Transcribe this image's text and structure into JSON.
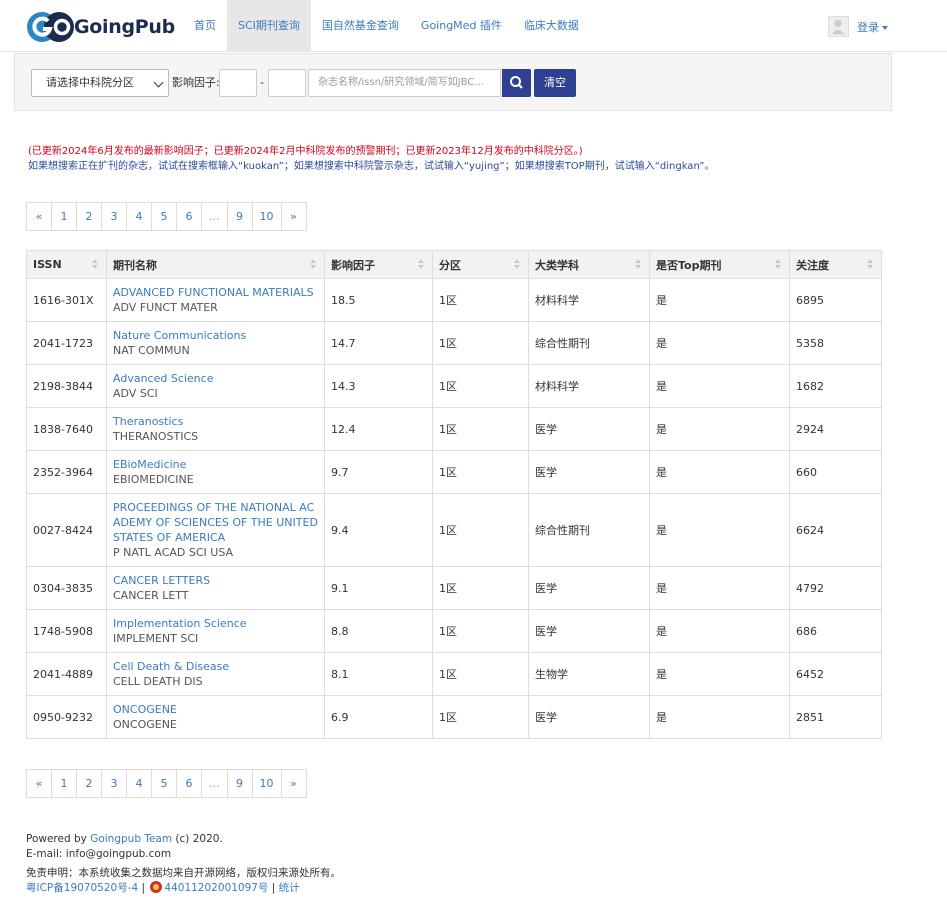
{
  "header": {
    "brand": "GoingPub",
    "nav": [
      "首页",
      "SCI期刊查询",
      "国自然基金查询",
      "GoingMed 插件",
      "临床大数据"
    ],
    "active_index": 1,
    "login": "登录"
  },
  "search": {
    "select_value": "请选择中科院分区",
    "impact_label": "影响因子:",
    "dash": "-",
    "placeholder": "杂志名称/issn/研究领域/简写如JBC...",
    "clear_label": "清空"
  },
  "notices": {
    "red": "(已更新2024年6月发布的最新影响因子；已更新2024年2月中科院发布的预警期刊；已更新2023年12月发布的中科院分区。)",
    "blue": "如果想搜索正在扩刊的杂志，试试在搜索框输入“kuokan”；如果想搜索中科院警示杂志，试试输入“yujing”；如果想搜索TOP期刊，试试输入“dingkan”。"
  },
  "pagination": [
    "«",
    "1",
    "2",
    "3",
    "4",
    "5",
    "6",
    "...",
    "9",
    "10",
    "»"
  ],
  "table": {
    "headers": [
      "ISSN",
      "期刊名称",
      "影响因子",
      "分区",
      "大类学科",
      "是否Top期刊",
      "关注度"
    ],
    "rows": [
      {
        "issn": "1616-301X",
        "name": "ADVANCED FUNCTIONAL MATERIALS",
        "abbr": "ADV FUNCT MATER",
        "if": "18.5",
        "zone": "1区",
        "subject": "材料科学",
        "top": "是",
        "attention": "6895"
      },
      {
        "issn": "2041-1723",
        "name": "Nature Communications",
        "abbr": "NAT COMMUN",
        "if": "14.7",
        "zone": "1区",
        "subject": "综合性期刊",
        "top": "是",
        "attention": "5358"
      },
      {
        "issn": "2198-3844",
        "name": "Advanced Science",
        "abbr": "ADV SCI",
        "if": "14.3",
        "zone": "1区",
        "subject": "材料科学",
        "top": "是",
        "attention": "1682"
      },
      {
        "issn": "1838-7640",
        "name": "Theranostics",
        "abbr": "THERANOSTICS",
        "if": "12.4",
        "zone": "1区",
        "subject": "医学",
        "top": "是",
        "attention": "2924"
      },
      {
        "issn": "2352-3964",
        "name": "EBioMedicine",
        "abbr": "EBIOMEDICINE",
        "if": "9.7",
        "zone": "1区",
        "subject": "医学",
        "top": "是",
        "attention": "660"
      },
      {
        "issn": "0027-8424",
        "name": "PROCEEDINGS OF THE NATIONAL ACADEMY OF SCIENCES OF THE UNITED STATES OF AMERICA",
        "abbr": "P NATL ACAD SCI USA",
        "if": "9.4",
        "zone": "1区",
        "subject": "综合性期刊",
        "top": "是",
        "attention": "6624"
      },
      {
        "issn": "0304-3835",
        "name": "CANCER LETTERS",
        "abbr": "CANCER LETT",
        "if": "9.1",
        "zone": "1区",
        "subject": "医学",
        "top": "是",
        "attention": "4792"
      },
      {
        "issn": "1748-5908",
        "name": "Implementation Science",
        "abbr": "IMPLEMENT SCI",
        "if": "8.8",
        "zone": "1区",
        "subject": "医学",
        "top": "是",
        "attention": "686"
      },
      {
        "issn": "2041-4889",
        "name": "Cell Death & Disease",
        "abbr": "CELL DEATH DIS",
        "if": "8.1",
        "zone": "1区",
        "subject": "生物学",
        "top": "是",
        "attention": "6452"
      },
      {
        "issn": "0950-9232",
        "name": "ONCOGENE",
        "abbr": "ONCOGENE",
        "if": "6.9",
        "zone": "1区",
        "subject": "医学",
        "top": "是",
        "attention": "2851"
      }
    ]
  },
  "footer": {
    "powered_prefix": "Powered by ",
    "team": "Goingpub Team",
    "powered_suffix": " (c) 2020.",
    "email": "E-mail: info@goingpub.com",
    "disclaimer": "免责申明：本系统收集之数据均来自开源网络，版权归来源处所有。",
    "icp": "粤ICP备19070520号-4",
    "sep1": " | ",
    "police": "44011202001097号",
    "sep2": " | ",
    "stats": "统计"
  },
  "colors": {
    "link": "#3a7bbf",
    "primary_button": "#2f3f91",
    "notice_red": "#d0021b",
    "notice_blue": "#2c4a96"
  }
}
